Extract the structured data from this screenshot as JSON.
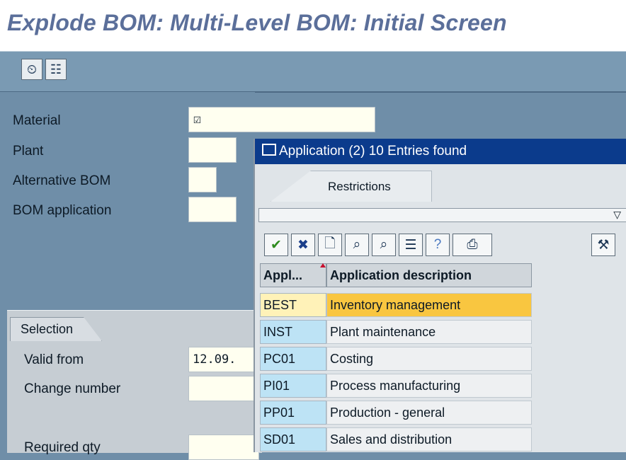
{
  "window": {
    "title": "Explode BOM: Multi-Level BOM: Initial Screen"
  },
  "toolbar": {
    "buttons": [
      {
        "icon": "execute-clock-icon",
        "glyph": "⏲"
      },
      {
        "icon": "document-person-icon",
        "glyph": "☷"
      }
    ]
  },
  "form": {
    "material_label": "Material",
    "material_value": "☑",
    "plant_label": "Plant",
    "plant_value": "",
    "alt_bom_label": "Alternative BOM",
    "alt_bom_value": "",
    "bom_app_label": "BOM application",
    "bom_app_value": ""
  },
  "selection": {
    "tab_label": "Selection",
    "valid_from_label": "Valid from",
    "valid_from_value": "12.09.",
    "change_number_label": "Change number",
    "change_number_value": "",
    "required_qty_label": "Required qty",
    "required_qty_value": ""
  },
  "popup": {
    "title": "Application (2)  10 Entries found",
    "tab_restrictions": "Restrictions",
    "collapse_glyph": "▽",
    "toolbar": [
      {
        "icon": "check-icon",
        "glyph": "✔",
        "color": "#2e8b1e"
      },
      {
        "icon": "cancel-x-icon",
        "glyph": "✖",
        "color": "#1b3f8a"
      },
      {
        "icon": "new-document-icon",
        "glyph": "🗋",
        "color": "#1b3553"
      },
      {
        "icon": "find-icon",
        "glyph": "⌕",
        "color": "#1b3553"
      },
      {
        "icon": "find-next-icon",
        "glyph": "⌕",
        "color": "#1b3553"
      },
      {
        "icon": "sort-icon",
        "glyph": "☰",
        "color": "#1b3553"
      },
      {
        "icon": "help-info-icon",
        "glyph": "?",
        "color": "#4a78c0"
      },
      {
        "icon": "print-icon",
        "glyph": "⎙",
        "color": "#1b3553"
      },
      {
        "icon": "settings-icon",
        "glyph": "⚒",
        "color": "#1b3553"
      }
    ],
    "columns": {
      "code": "Appl...",
      "description": "Application description"
    },
    "rows": [
      {
        "code": "BEST",
        "description": "Inventory management",
        "selected": true
      },
      {
        "code": "INST",
        "description": "Plant maintenance"
      },
      {
        "code": "PC01",
        "description": "Costing"
      },
      {
        "code": "PI01",
        "description": "Process manufacturing"
      },
      {
        "code": "PP01",
        "description": "Production - general"
      },
      {
        "code": "SD01",
        "description": "Sales and distribution"
      }
    ]
  },
  "colors": {
    "title": "#5b6f9a",
    "popup_title_bar": "#0b3b8c",
    "selected_row": "#f9c640",
    "code_cell": "#bde3f5"
  }
}
